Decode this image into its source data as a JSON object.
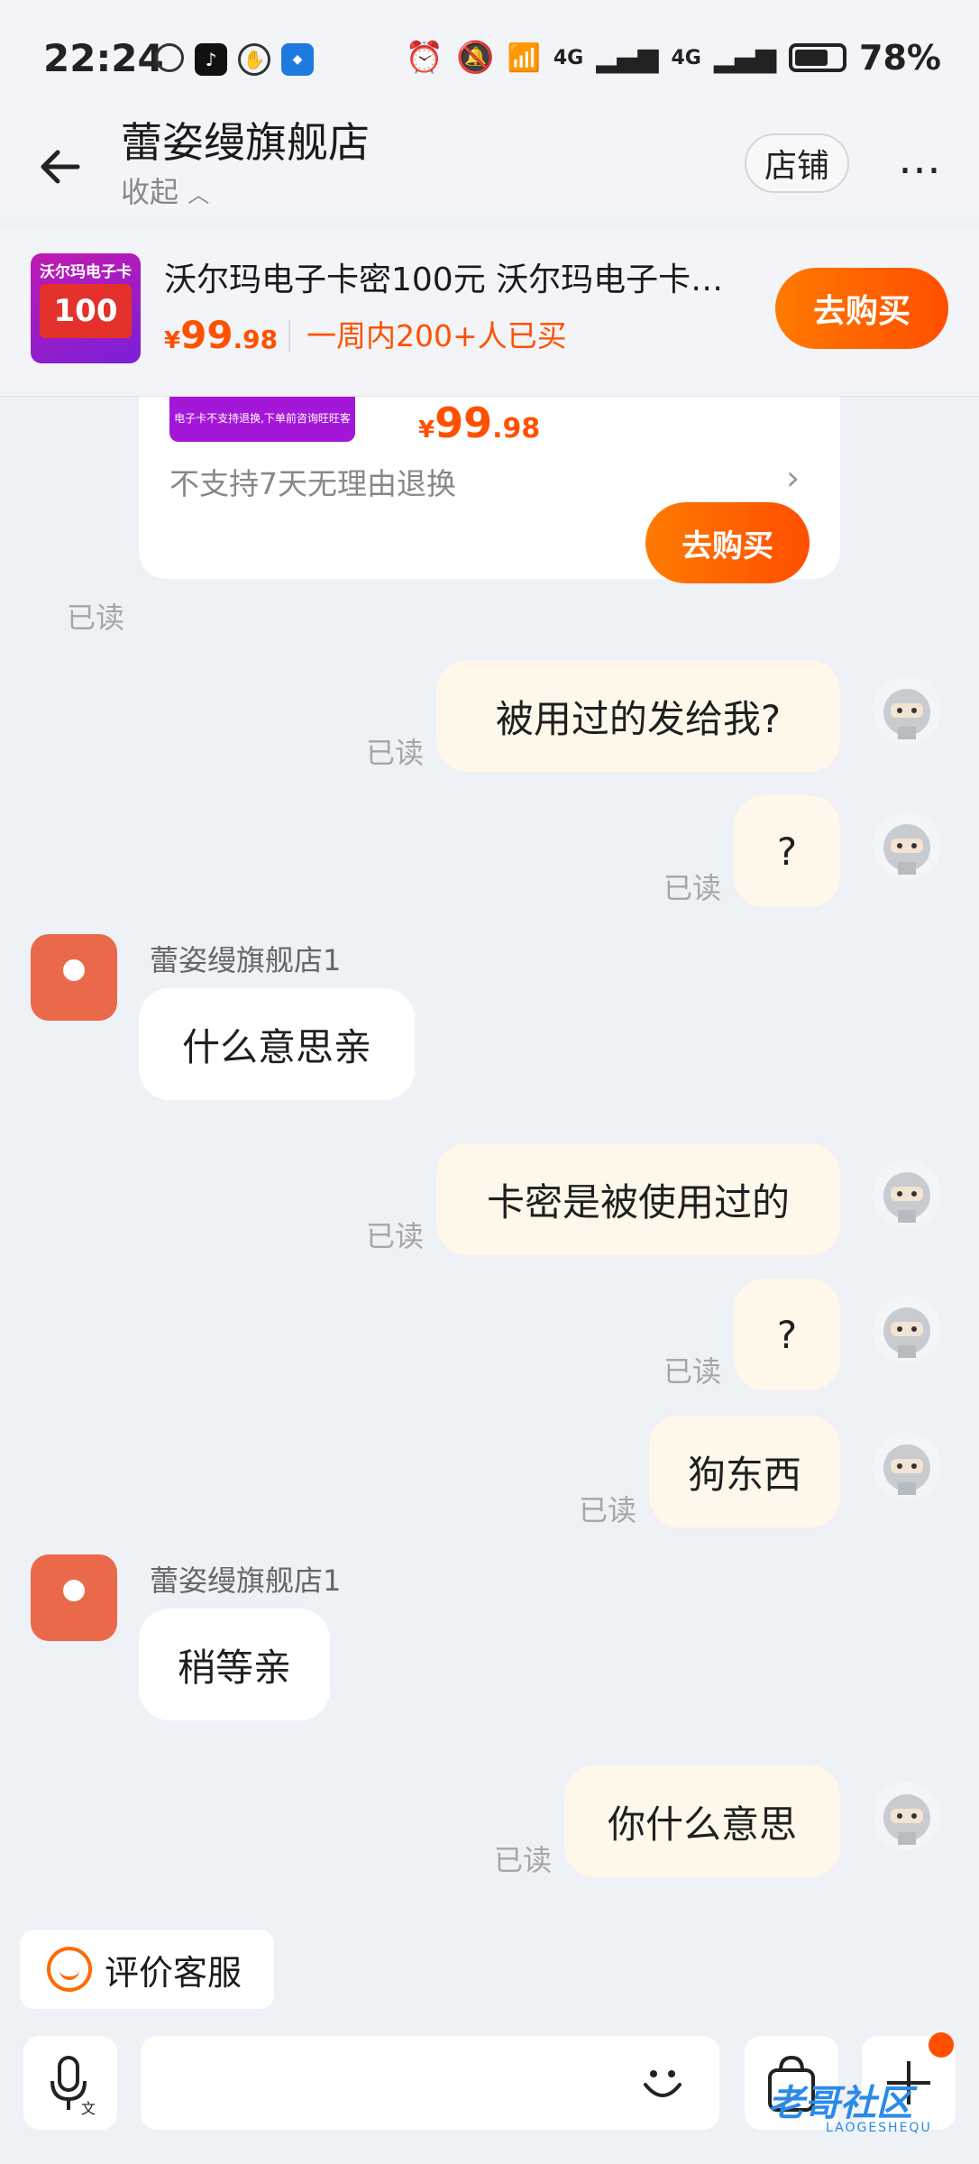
{
  "status": {
    "time": "22:24",
    "battery": "78%",
    "net1": "4G",
    "net2": "4G"
  },
  "header": {
    "title": "蕾姿缦旗舰店",
    "collapse": "收起",
    "shop_btn": "店铺",
    "more": "⋯"
  },
  "product": {
    "thumb_text": "沃尔玛电子卡",
    "thumb_value": "100",
    "title": "沃尔玛电子卡密100元  沃尔玛电子卡…",
    "currency": "¥",
    "price_int": "99",
    "price_dec": ".98",
    "sold": "一周内200+人已买",
    "buy": "去购买"
  },
  "card": {
    "thumb_caption": "电子卡不支持退换,下单前咨询旺旺客服",
    "currency": "¥",
    "price_int": "99",
    "price_dec": ".98",
    "policy": "不支持7天无理由退换",
    "buy": "去购买",
    "read": "已读"
  },
  "messages": {
    "m1": {
      "text": "被用过的发给我?",
      "read": "已读"
    },
    "m2": {
      "text": "?",
      "read": "已读"
    },
    "s1": {
      "sender": "蕾姿缦旗舰店1",
      "text": "什么意思亲"
    },
    "m3": {
      "text": "卡密是被使用过的",
      "read": "已读"
    },
    "m4": {
      "text": "?",
      "read": "已读"
    },
    "m5": {
      "text": "狗东西",
      "read": "已读"
    },
    "s2": {
      "sender": "蕾姿缦旗舰店1",
      "text": "稍等亲"
    },
    "m6": {
      "text": "你什么意思",
      "read": "已读"
    }
  },
  "bottom": {
    "rate": "评价客服",
    "watermark": "老哥社区",
    "watermark_sub": "LAOGESHEQU"
  },
  "colors": {
    "accent": "#ff5000",
    "shop_avatar": "#e9694a",
    "my_bubble": "#fff7ea"
  }
}
